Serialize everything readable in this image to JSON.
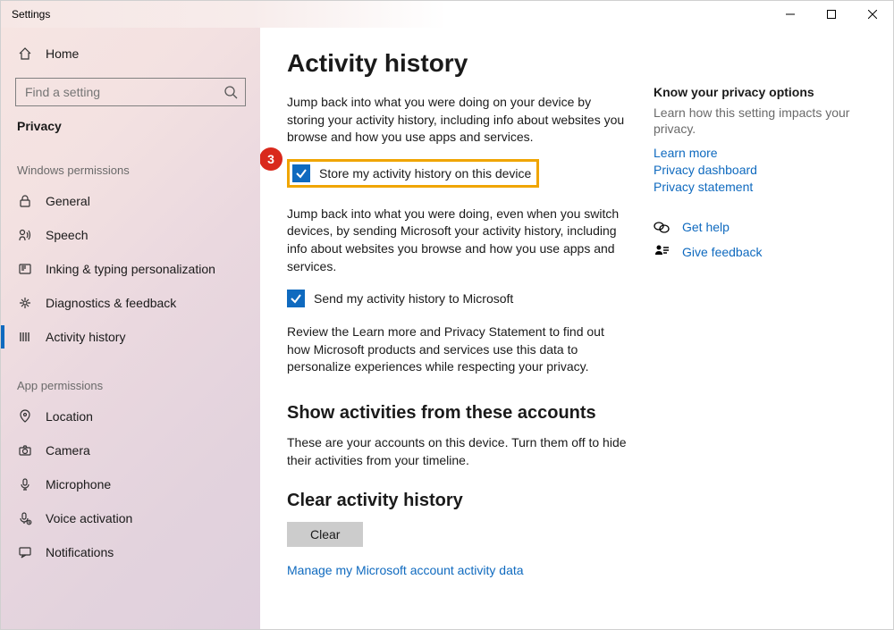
{
  "window": {
    "title": "Settings"
  },
  "sidebar": {
    "home": "Home",
    "search_placeholder": "Find a setting",
    "current": "Privacy",
    "section1": "Windows permissions",
    "items1": [
      {
        "icon": "lock-icon",
        "label": "General"
      },
      {
        "icon": "speech-icon",
        "label": "Speech"
      },
      {
        "icon": "inking-icon",
        "label": "Inking & typing personalization"
      },
      {
        "icon": "diagnostics-icon",
        "label": "Diagnostics & feedback"
      },
      {
        "icon": "activity-icon",
        "label": "Activity history"
      }
    ],
    "section2": "App permissions",
    "items2": [
      {
        "icon": "location-icon",
        "label": "Location"
      },
      {
        "icon": "camera-icon",
        "label": "Camera"
      },
      {
        "icon": "microphone-icon",
        "label": "Microphone"
      },
      {
        "icon": "voice-icon",
        "label": "Voice activation"
      },
      {
        "icon": "notifications-icon",
        "label": "Notifications"
      }
    ]
  },
  "main": {
    "title": "Activity history",
    "p1": "Jump back into what you were doing on your device by storing your activity history, including info about websites you browse and how you use apps and services.",
    "cb1": "Store my activity history on this device",
    "callout": "3",
    "p2": "Jump back into what you were doing, even when you switch devices, by sending Microsoft your activity history, including info about websites you browse and how you use apps and services.",
    "cb2": "Send my activity history to Microsoft",
    "p3": "Review the Learn more and Privacy Statement to find out how Microsoft products and services use this data to personalize experiences while respecting your privacy.",
    "h2": "Show activities from these accounts",
    "p4": "These are your accounts on this device. Turn them off to hide their activities from your timeline.",
    "h3": "Clear activity history",
    "clear": "Clear",
    "manage_link": "Manage my Microsoft account activity data"
  },
  "side": {
    "head": "Know your privacy options",
    "sub": "Learn how this setting impacts your privacy.",
    "links": [
      "Learn more",
      "Privacy dashboard",
      "Privacy statement"
    ],
    "help": "Get help",
    "feedback": "Give feedback"
  }
}
